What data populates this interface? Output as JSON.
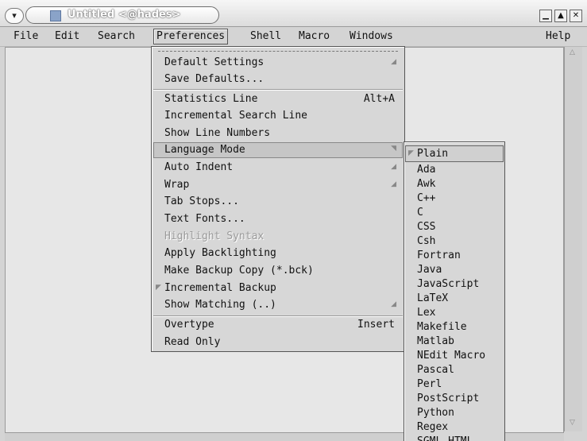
{
  "window": {
    "title": "Untitled <@hades>",
    "controls": [
      "minimize",
      "maximize",
      "close"
    ]
  },
  "menubar": {
    "items": [
      "File",
      "Edit",
      "Search",
      "Preferences",
      "Shell",
      "Macro",
      "Windows"
    ],
    "help": "Help",
    "active": "Preferences"
  },
  "preferences_menu": {
    "items": [
      {
        "label": "Default Settings",
        "cascade": true
      },
      {
        "label": "Save Defaults..."
      },
      {
        "label": "Statistics Line",
        "accelerator": "Alt+A"
      },
      {
        "label": "Incremental Search Line"
      },
      {
        "label": "Show Line Numbers"
      },
      {
        "label": "Language Mode",
        "cascade": true,
        "highlighted": true
      },
      {
        "label": "Auto Indent",
        "cascade": true
      },
      {
        "label": "Wrap",
        "cascade": true
      },
      {
        "label": "Tab Stops..."
      },
      {
        "label": "Text Fonts..."
      },
      {
        "label": "Highlight Syntax",
        "disabled": true
      },
      {
        "label": "Apply Backlighting"
      },
      {
        "label": "Make Backup Copy (*.bck)"
      },
      {
        "label": "Incremental Backup",
        "toggle": true
      },
      {
        "label": "Show Matching (..)",
        "cascade": true
      },
      {
        "label": "Overtype",
        "accelerator": "Insert"
      },
      {
        "label": "Read Only"
      }
    ]
  },
  "language_submenu": {
    "items": [
      "Plain",
      "Ada",
      "Awk",
      "C++",
      "C",
      "CSS",
      "Csh",
      "Fortran",
      "Java",
      "JavaScript",
      "LaTeX",
      "Lex",
      "Makefile",
      "Matlab",
      "NEdit Macro",
      "Pascal",
      "Perl",
      "PostScript",
      "Python",
      "Regex",
      "SGML HTML"
    ],
    "selected": "Plain"
  }
}
